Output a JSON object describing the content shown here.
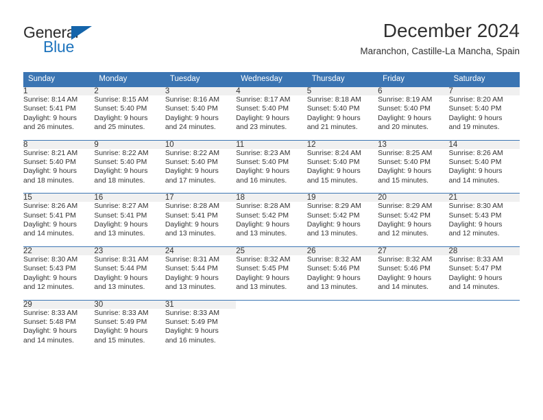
{
  "brand": {
    "name_part1": "General",
    "name_part2": "Blue",
    "triangle_color": "#1464aa",
    "blue_color": "#1e74bd"
  },
  "header": {
    "title": "December 2024",
    "subtitle": "Maranchon, Castille-La Mancha, Spain"
  },
  "theme": {
    "header_blue": "#3b75b3",
    "daynum_gray": "#f0f0f0",
    "text": "#333333"
  },
  "weekdays": [
    "Sunday",
    "Monday",
    "Tuesday",
    "Wednesday",
    "Thursday",
    "Friday",
    "Saturday"
  ],
  "weeks": [
    [
      {
        "day": "1",
        "sunrise": "Sunrise: 8:14 AM",
        "sunset": "Sunset: 5:41 PM",
        "daylight1": "Daylight: 9 hours",
        "daylight2": "and 26 minutes."
      },
      {
        "day": "2",
        "sunrise": "Sunrise: 8:15 AM",
        "sunset": "Sunset: 5:40 PM",
        "daylight1": "Daylight: 9 hours",
        "daylight2": "and 25 minutes."
      },
      {
        "day": "3",
        "sunrise": "Sunrise: 8:16 AM",
        "sunset": "Sunset: 5:40 PM",
        "daylight1": "Daylight: 9 hours",
        "daylight2": "and 24 minutes."
      },
      {
        "day": "4",
        "sunrise": "Sunrise: 8:17 AM",
        "sunset": "Sunset: 5:40 PM",
        "daylight1": "Daylight: 9 hours",
        "daylight2": "and 23 minutes."
      },
      {
        "day": "5",
        "sunrise": "Sunrise: 8:18 AM",
        "sunset": "Sunset: 5:40 PM",
        "daylight1": "Daylight: 9 hours",
        "daylight2": "and 21 minutes."
      },
      {
        "day": "6",
        "sunrise": "Sunrise: 8:19 AM",
        "sunset": "Sunset: 5:40 PM",
        "daylight1": "Daylight: 9 hours",
        "daylight2": "and 20 minutes."
      },
      {
        "day": "7",
        "sunrise": "Sunrise: 8:20 AM",
        "sunset": "Sunset: 5:40 PM",
        "daylight1": "Daylight: 9 hours",
        "daylight2": "and 19 minutes."
      }
    ],
    [
      {
        "day": "8",
        "sunrise": "Sunrise: 8:21 AM",
        "sunset": "Sunset: 5:40 PM",
        "daylight1": "Daylight: 9 hours",
        "daylight2": "and 18 minutes."
      },
      {
        "day": "9",
        "sunrise": "Sunrise: 8:22 AM",
        "sunset": "Sunset: 5:40 PM",
        "daylight1": "Daylight: 9 hours",
        "daylight2": "and 18 minutes."
      },
      {
        "day": "10",
        "sunrise": "Sunrise: 8:22 AM",
        "sunset": "Sunset: 5:40 PM",
        "daylight1": "Daylight: 9 hours",
        "daylight2": "and 17 minutes."
      },
      {
        "day": "11",
        "sunrise": "Sunrise: 8:23 AM",
        "sunset": "Sunset: 5:40 PM",
        "daylight1": "Daylight: 9 hours",
        "daylight2": "and 16 minutes."
      },
      {
        "day": "12",
        "sunrise": "Sunrise: 8:24 AM",
        "sunset": "Sunset: 5:40 PM",
        "daylight1": "Daylight: 9 hours",
        "daylight2": "and 15 minutes."
      },
      {
        "day": "13",
        "sunrise": "Sunrise: 8:25 AM",
        "sunset": "Sunset: 5:40 PM",
        "daylight1": "Daylight: 9 hours",
        "daylight2": "and 15 minutes."
      },
      {
        "day": "14",
        "sunrise": "Sunrise: 8:26 AM",
        "sunset": "Sunset: 5:40 PM",
        "daylight1": "Daylight: 9 hours",
        "daylight2": "and 14 minutes."
      }
    ],
    [
      {
        "day": "15",
        "sunrise": "Sunrise: 8:26 AM",
        "sunset": "Sunset: 5:41 PM",
        "daylight1": "Daylight: 9 hours",
        "daylight2": "and 14 minutes."
      },
      {
        "day": "16",
        "sunrise": "Sunrise: 8:27 AM",
        "sunset": "Sunset: 5:41 PM",
        "daylight1": "Daylight: 9 hours",
        "daylight2": "and 13 minutes."
      },
      {
        "day": "17",
        "sunrise": "Sunrise: 8:28 AM",
        "sunset": "Sunset: 5:41 PM",
        "daylight1": "Daylight: 9 hours",
        "daylight2": "and 13 minutes."
      },
      {
        "day": "18",
        "sunrise": "Sunrise: 8:28 AM",
        "sunset": "Sunset: 5:42 PM",
        "daylight1": "Daylight: 9 hours",
        "daylight2": "and 13 minutes."
      },
      {
        "day": "19",
        "sunrise": "Sunrise: 8:29 AM",
        "sunset": "Sunset: 5:42 PM",
        "daylight1": "Daylight: 9 hours",
        "daylight2": "and 13 minutes."
      },
      {
        "day": "20",
        "sunrise": "Sunrise: 8:29 AM",
        "sunset": "Sunset: 5:42 PM",
        "daylight1": "Daylight: 9 hours",
        "daylight2": "and 12 minutes."
      },
      {
        "day": "21",
        "sunrise": "Sunrise: 8:30 AM",
        "sunset": "Sunset: 5:43 PM",
        "daylight1": "Daylight: 9 hours",
        "daylight2": "and 12 minutes."
      }
    ],
    [
      {
        "day": "22",
        "sunrise": "Sunrise: 8:30 AM",
        "sunset": "Sunset: 5:43 PM",
        "daylight1": "Daylight: 9 hours",
        "daylight2": "and 12 minutes."
      },
      {
        "day": "23",
        "sunrise": "Sunrise: 8:31 AM",
        "sunset": "Sunset: 5:44 PM",
        "daylight1": "Daylight: 9 hours",
        "daylight2": "and 13 minutes."
      },
      {
        "day": "24",
        "sunrise": "Sunrise: 8:31 AM",
        "sunset": "Sunset: 5:44 PM",
        "daylight1": "Daylight: 9 hours",
        "daylight2": "and 13 minutes."
      },
      {
        "day": "25",
        "sunrise": "Sunrise: 8:32 AM",
        "sunset": "Sunset: 5:45 PM",
        "daylight1": "Daylight: 9 hours",
        "daylight2": "and 13 minutes."
      },
      {
        "day": "26",
        "sunrise": "Sunrise: 8:32 AM",
        "sunset": "Sunset: 5:46 PM",
        "daylight1": "Daylight: 9 hours",
        "daylight2": "and 13 minutes."
      },
      {
        "day": "27",
        "sunrise": "Sunrise: 8:32 AM",
        "sunset": "Sunset: 5:46 PM",
        "daylight1": "Daylight: 9 hours",
        "daylight2": "and 14 minutes."
      },
      {
        "day": "28",
        "sunrise": "Sunrise: 8:33 AM",
        "sunset": "Sunset: 5:47 PM",
        "daylight1": "Daylight: 9 hours",
        "daylight2": "and 14 minutes."
      }
    ],
    [
      {
        "day": "29",
        "sunrise": "Sunrise: 8:33 AM",
        "sunset": "Sunset: 5:48 PM",
        "daylight1": "Daylight: 9 hours",
        "daylight2": "and 14 minutes."
      },
      {
        "day": "30",
        "sunrise": "Sunrise: 8:33 AM",
        "sunset": "Sunset: 5:49 PM",
        "daylight1": "Daylight: 9 hours",
        "daylight2": "and 15 minutes."
      },
      {
        "day": "31",
        "sunrise": "Sunrise: 8:33 AM",
        "sunset": "Sunset: 5:49 PM",
        "daylight1": "Daylight: 9 hours",
        "daylight2": "and 16 minutes."
      },
      {
        "day": "",
        "sunrise": "",
        "sunset": "",
        "daylight1": "",
        "daylight2": ""
      },
      {
        "day": "",
        "sunrise": "",
        "sunset": "",
        "daylight1": "",
        "daylight2": ""
      },
      {
        "day": "",
        "sunrise": "",
        "sunset": "",
        "daylight1": "",
        "daylight2": ""
      },
      {
        "day": "",
        "sunrise": "",
        "sunset": "",
        "daylight1": "",
        "daylight2": ""
      }
    ]
  ]
}
